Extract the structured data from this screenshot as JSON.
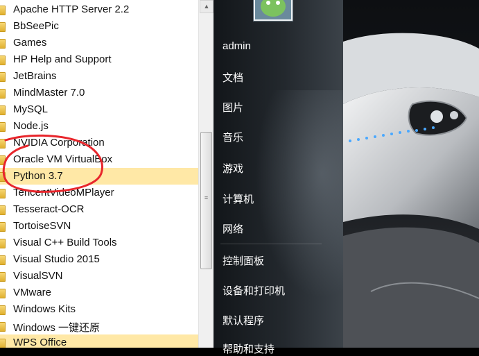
{
  "programs": [
    {
      "label": "Apache HTTP Server 2.2",
      "highlighted": false
    },
    {
      "label": "BbSeePic",
      "highlighted": false
    },
    {
      "label": "Games",
      "highlighted": false
    },
    {
      "label": "HP Help and Support",
      "highlighted": false
    },
    {
      "label": "JetBrains",
      "highlighted": false
    },
    {
      "label": "MindMaster 7.0",
      "highlighted": false
    },
    {
      "label": "MySQL",
      "highlighted": false
    },
    {
      "label": "Node.js",
      "highlighted": false
    },
    {
      "label": "NVIDIA Corporation",
      "highlighted": false
    },
    {
      "label": "Oracle VM VirtualBox",
      "highlighted": false
    },
    {
      "label": "Python 3.7",
      "highlighted": true
    },
    {
      "label": "TencentVideoMPlayer",
      "highlighted": false
    },
    {
      "label": "Tesseract-OCR",
      "highlighted": false
    },
    {
      "label": "TortoiseSVN",
      "highlighted": false
    },
    {
      "label": "Visual C++ Build Tools",
      "highlighted": false
    },
    {
      "label": "Visual Studio 2015",
      "highlighted": false
    },
    {
      "label": "VisualSVN",
      "highlighted": false
    },
    {
      "label": "VMware",
      "highlighted": false
    },
    {
      "label": "Windows Kits",
      "highlighted": false
    },
    {
      "label": "Windows 一键还原",
      "highlighted": false
    },
    {
      "label": "WPS Office",
      "highlighted": true
    }
  ],
  "right_menu": {
    "user": "admin",
    "items": [
      "文档",
      "图片",
      "音乐",
      "游戏",
      "计算机",
      "网络",
      "控制面板",
      "设备和打印机",
      "默认程序",
      "帮助和支持"
    ]
  },
  "colors": {
    "highlight": "#ffe8a6",
    "annotation": "#e8262c",
    "menu_text": "#ffffff"
  },
  "icons": {
    "folder": "folder-icon",
    "avatar": "user-avatar-image"
  }
}
